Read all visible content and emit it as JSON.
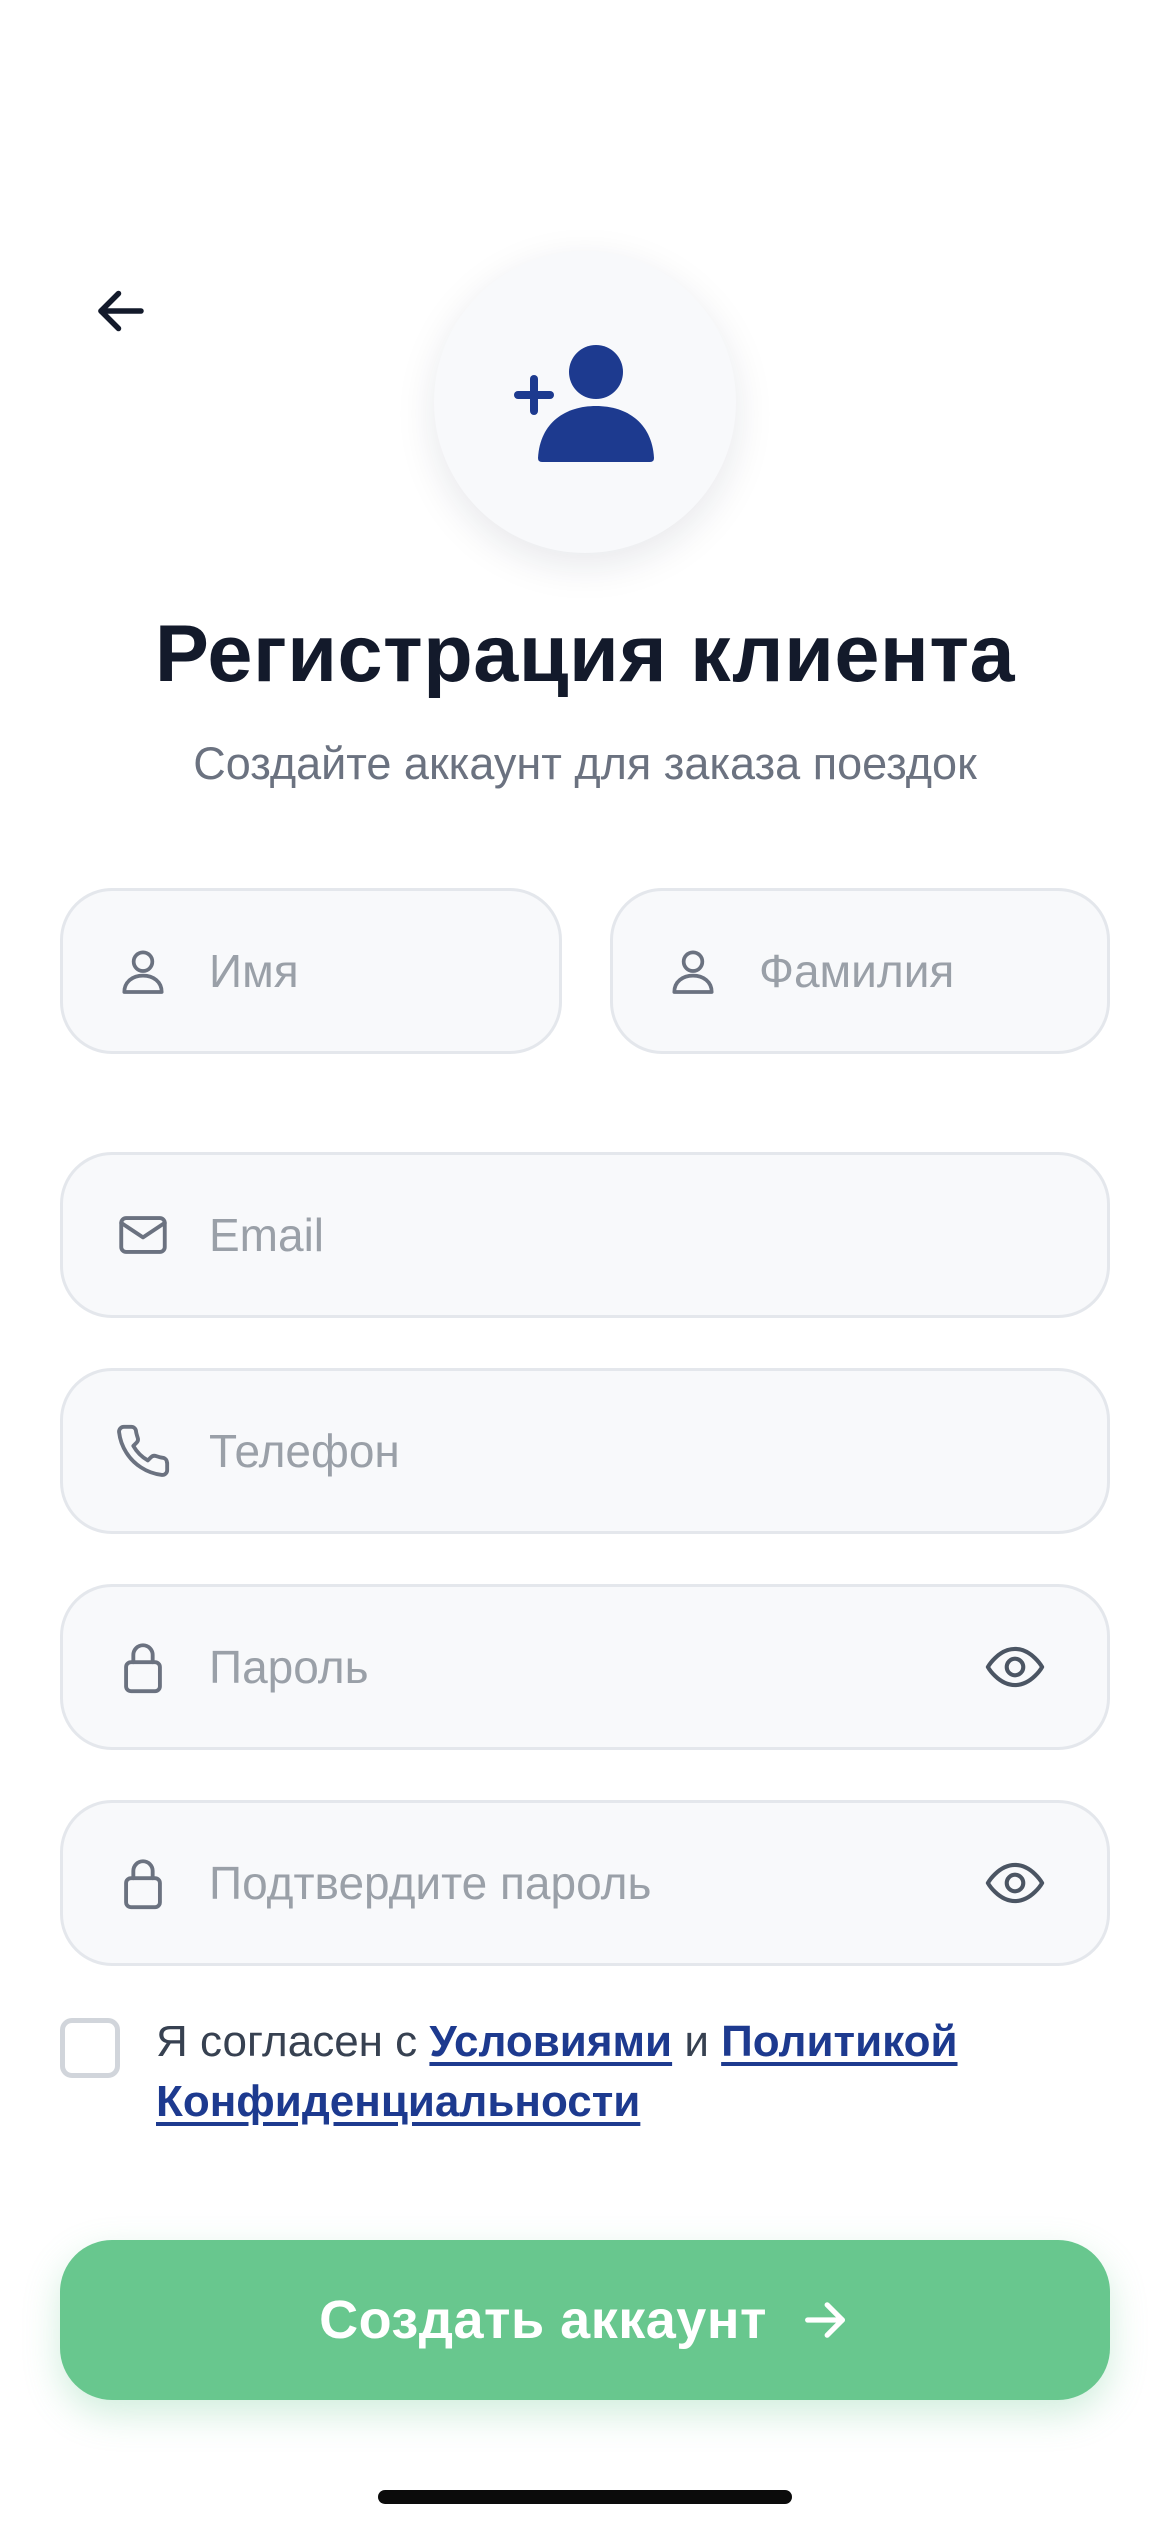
{
  "header": {
    "back_icon": "arrow-left-icon",
    "avatar_icon": "user-add-icon",
    "title": "Регистрация клиента",
    "subtitle": "Создайте аккаунт для заказа поездок"
  },
  "form": {
    "first_name": {
      "placeholder": "Имя",
      "icon": "user-icon"
    },
    "last_name": {
      "placeholder": "Фамилия",
      "icon": "user-icon"
    },
    "email": {
      "placeholder": "Email",
      "icon": "mail-icon"
    },
    "phone": {
      "placeholder": "Телефон",
      "icon": "phone-icon"
    },
    "password": {
      "placeholder": "Пароль",
      "icon": "lock-icon",
      "toggle_icon": "eye-icon"
    },
    "confirm_password": {
      "placeholder": "Подтвердите пароль",
      "icon": "lock-icon",
      "toggle_icon": "eye-icon"
    }
  },
  "terms": {
    "checked": false,
    "prefix": "Я согласен с ",
    "terms_link": "Условиями",
    "conjunction": " и ",
    "privacy_link_1": "Политикой",
    "privacy_link_2": "Конфиденциальности"
  },
  "cta": {
    "label": "Создать аккаунт",
    "icon": "arrow-right-icon"
  },
  "colors": {
    "brand": "#1d3a8f",
    "cta": "#68c78e",
    "field_bg": "#f8f9fb",
    "field_border": "#e4e7ec",
    "title": "#131a2b",
    "placeholder": "#9aa0a8"
  }
}
